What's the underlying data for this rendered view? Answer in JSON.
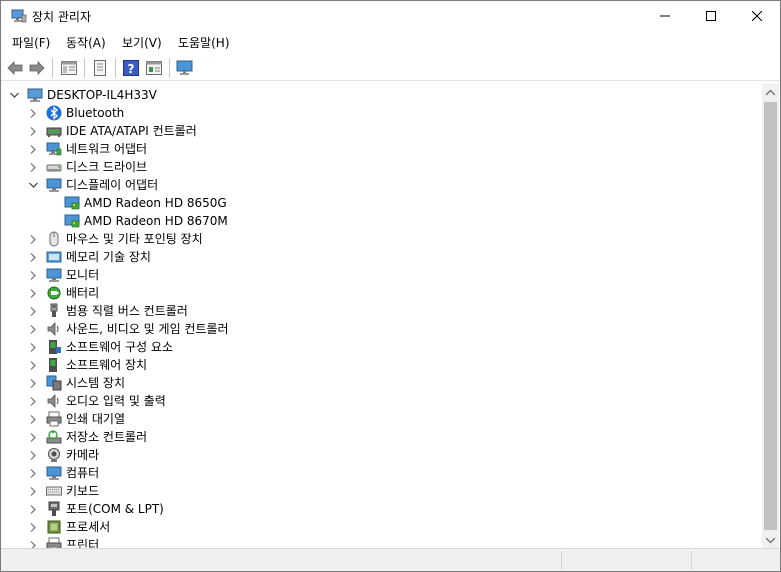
{
  "window": {
    "title": "장치 관리자"
  },
  "menu": [
    {
      "label": "파일(F)"
    },
    {
      "label": "동작(A)"
    },
    {
      "label": "보기(V)"
    },
    {
      "label": "도움말(H)"
    }
  ],
  "toolbar": [
    {
      "icon": "back-arrow-icon"
    },
    {
      "icon": "forward-arrow-icon"
    },
    {
      "icon": "properties-icon"
    },
    {
      "icon": "update-driver-icon"
    },
    {
      "icon": "help-icon"
    },
    {
      "icon": "action-view-icon"
    },
    {
      "icon": "monitor-scan-icon"
    }
  ],
  "tree": {
    "root": "DESKTOP-IL4H33V",
    "categories": [
      {
        "label": "Bluetooth",
        "icon": "bluetooth-icon"
      },
      {
        "label": "IDE ATA/ATAPI 컨트롤러",
        "icon": "ide-controller-icon"
      },
      {
        "label": "네트워크 어댑터",
        "icon": "network-adapter-icon"
      },
      {
        "label": "디스크 드라이브",
        "icon": "disk-drive-icon"
      },
      {
        "label": "디스플레이 어댑터",
        "icon": "display-adapter-icon",
        "expanded": true,
        "children": [
          {
            "label": "AMD Radeon HD 8650G"
          },
          {
            "label": "AMD Radeon HD 8670M"
          }
        ]
      },
      {
        "label": "마우스 및 기타 포인팅 장치",
        "icon": "mouse-icon"
      },
      {
        "label": "메모리 기술 장치",
        "icon": "memory-device-icon"
      },
      {
        "label": "모니터",
        "icon": "monitor-icon"
      },
      {
        "label": "배터리",
        "icon": "battery-icon"
      },
      {
        "label": "범용 직렬 버스 컨트롤러",
        "icon": "usb-icon"
      },
      {
        "label": "사운드, 비디오 및 게임 컨트롤러",
        "icon": "speaker-icon"
      },
      {
        "label": "소프트웨어 구성 요소",
        "icon": "software-component-icon"
      },
      {
        "label": "소프트웨어 장치",
        "icon": "software-device-icon"
      },
      {
        "label": "시스템 장치",
        "icon": "system-device-icon"
      },
      {
        "label": "오디오 입력 및 출력",
        "icon": "audio-io-icon"
      },
      {
        "label": "인쇄 대기열",
        "icon": "print-queue-icon"
      },
      {
        "label": "저장소 컨트롤러",
        "icon": "storage-controller-icon"
      },
      {
        "label": "카메라",
        "icon": "camera-icon"
      },
      {
        "label": "컴퓨터",
        "icon": "computer-icon"
      },
      {
        "label": "키보드",
        "icon": "keyboard-icon"
      },
      {
        "label": "포트(COM & LPT)",
        "icon": "port-icon"
      },
      {
        "label": "프로세서",
        "icon": "processor-icon"
      },
      {
        "label": "프린터",
        "icon": "printer-icon"
      }
    ]
  }
}
